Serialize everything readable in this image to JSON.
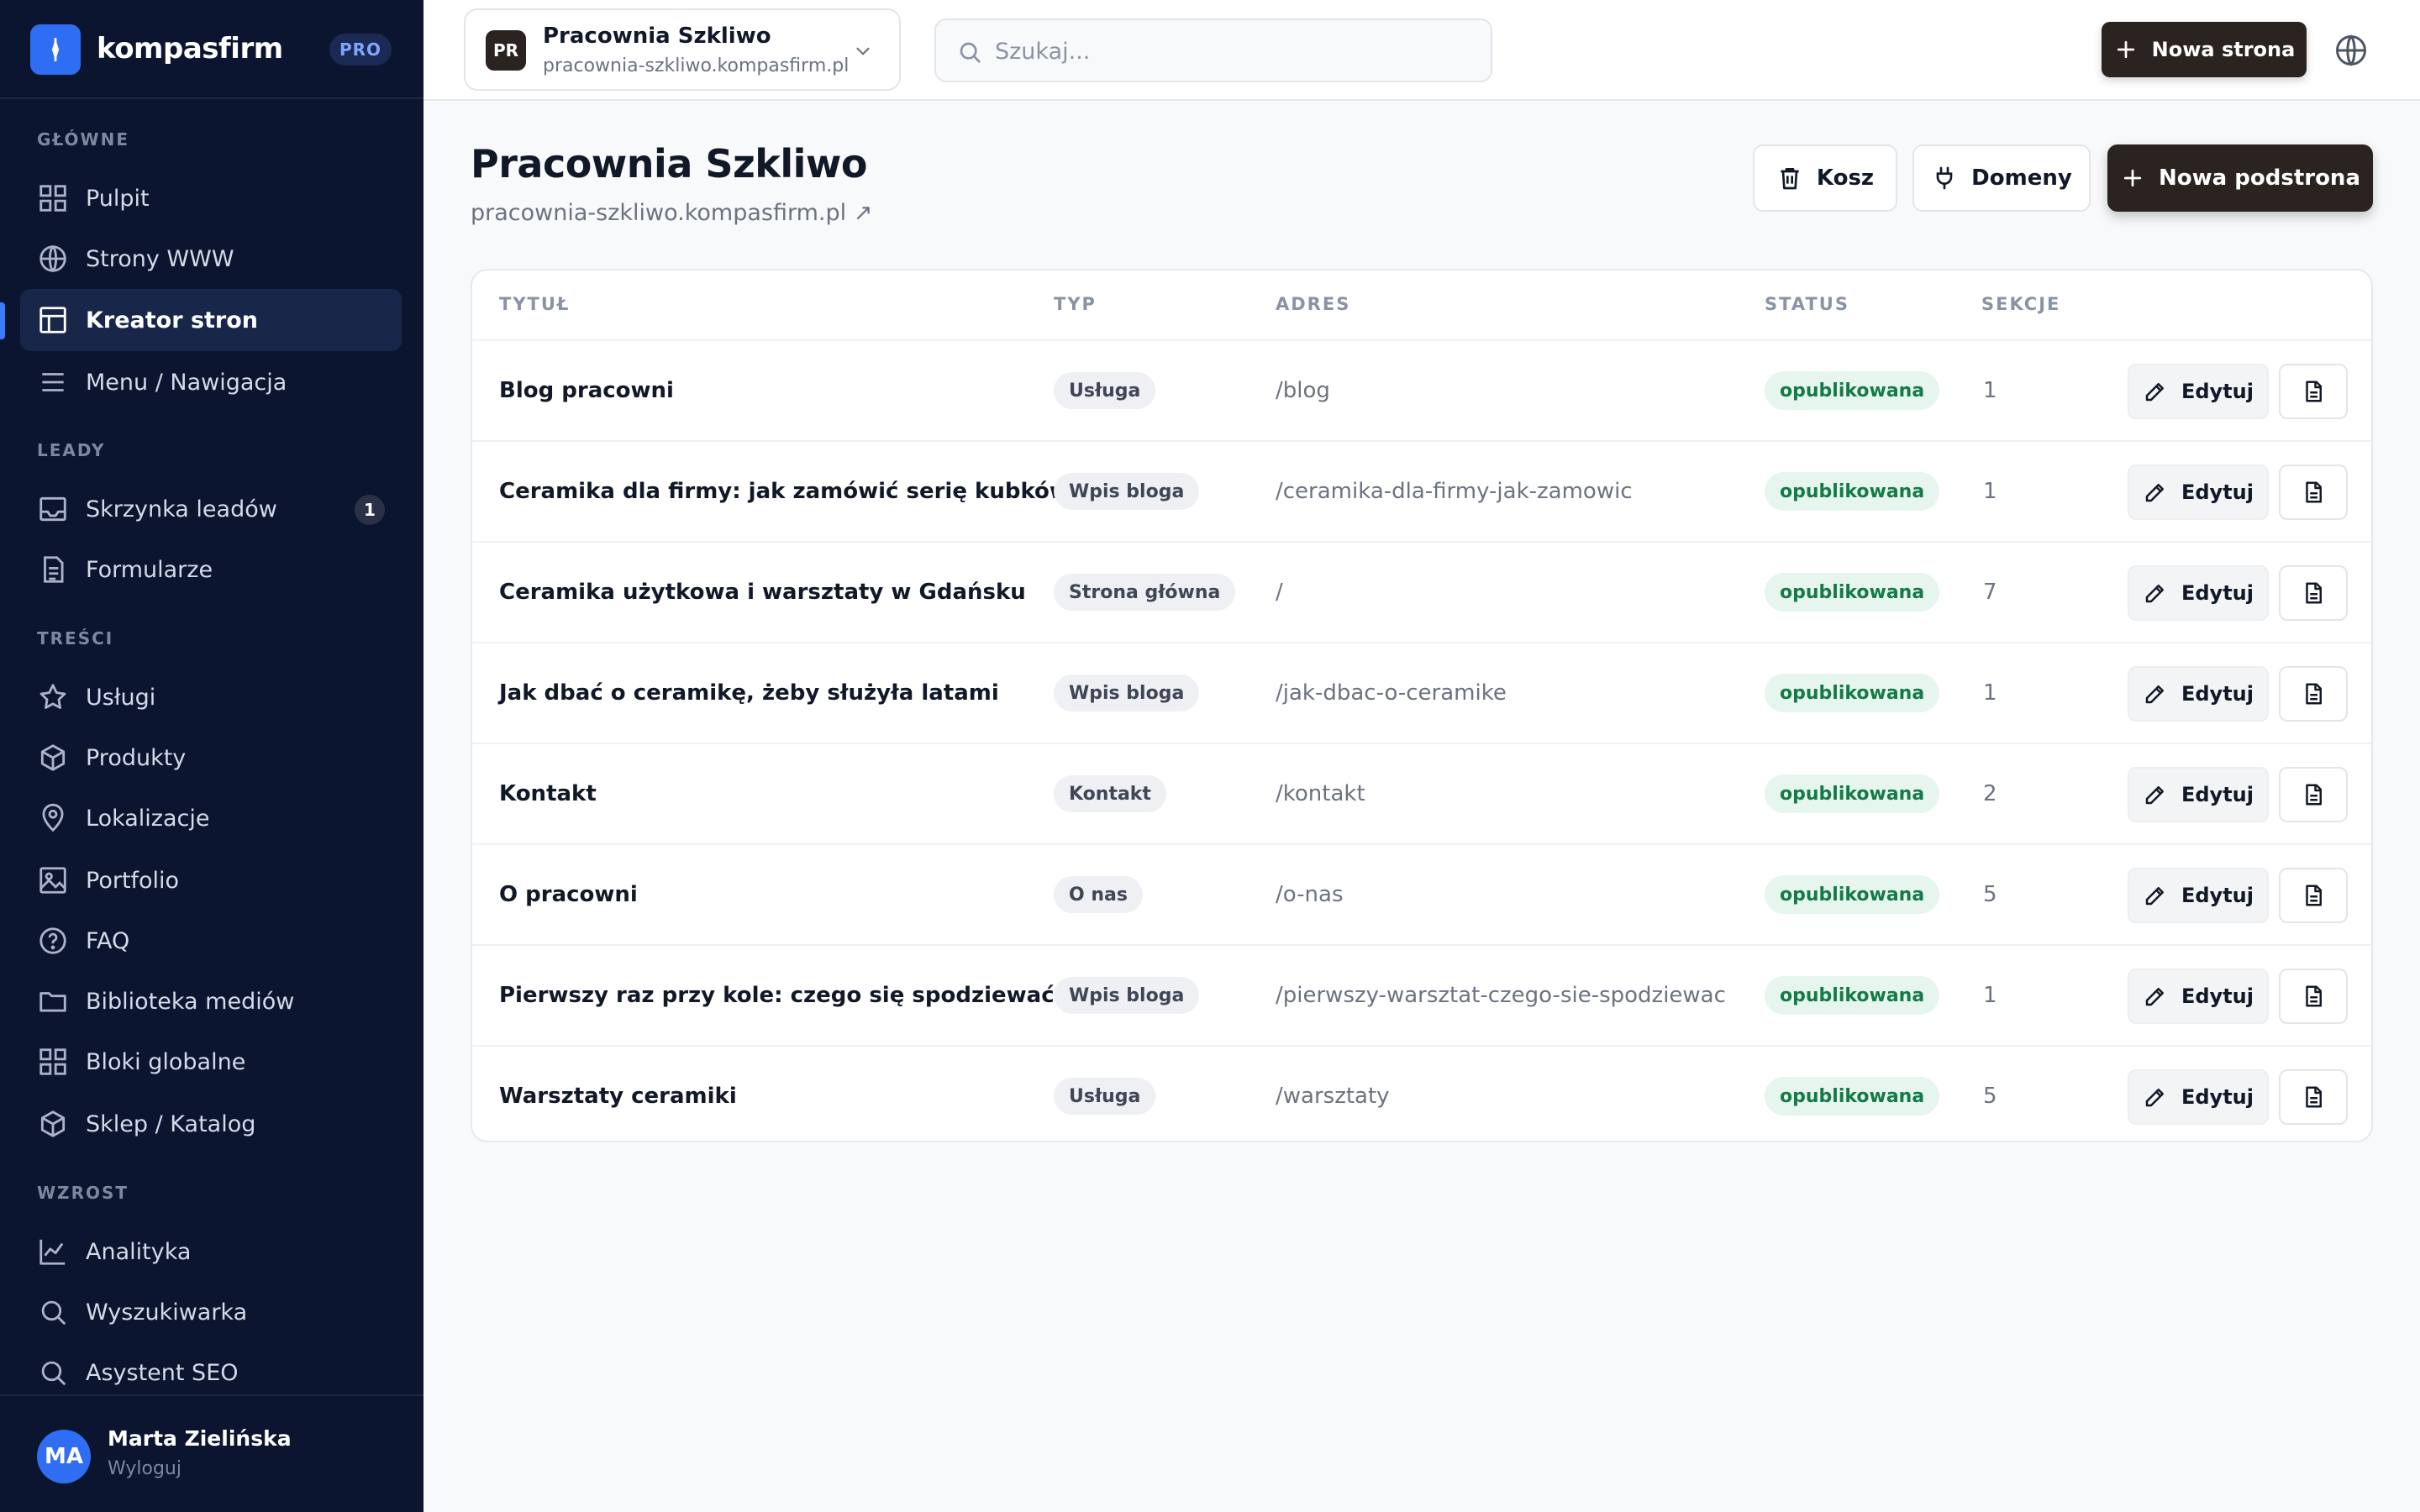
{
  "brand": {
    "name": "kompasfirm",
    "plan": "PRO"
  },
  "sidebar": {
    "sections": [
      {
        "title": "GŁÓWNE"
      },
      {
        "title": "LEADY"
      },
      {
        "title": "TREŚCI"
      },
      {
        "title": "WZROST"
      }
    ],
    "items": [
      {
        "label": "Pulpit",
        "icon": "grid-icon"
      },
      {
        "label": "Strony WWW",
        "icon": "globe-icon"
      },
      {
        "label": "Kreator stron",
        "icon": "layout-icon",
        "active": true
      },
      {
        "label": "Menu / Nawigacja",
        "icon": "menu-icon"
      },
      {
        "label": "Skrzynka leadów",
        "icon": "inbox-icon",
        "badge": "1"
      },
      {
        "label": "Formularze",
        "icon": "form-icon"
      },
      {
        "label": "Usługi",
        "icon": "star-icon"
      },
      {
        "label": "Produkty",
        "icon": "box-icon"
      },
      {
        "label": "Lokalizacje",
        "icon": "pin-icon"
      },
      {
        "label": "Portfolio",
        "icon": "image-icon"
      },
      {
        "label": "FAQ",
        "icon": "help-icon"
      },
      {
        "label": "Biblioteka mediów",
        "icon": "folder-icon"
      },
      {
        "label": "Bloki globalne",
        "icon": "grid-icon"
      },
      {
        "label": "Sklep / Katalog",
        "icon": "box-icon"
      },
      {
        "label": "Analityka",
        "icon": "chart-icon"
      },
      {
        "label": "Wyszukiwarka",
        "icon": "search-icon"
      },
      {
        "label": "Asystent SEO",
        "icon": "search-icon"
      }
    ]
  },
  "user": {
    "initials": "MA",
    "name": "Marta Zielińska",
    "logout": "Wyloguj"
  },
  "topbar": {
    "site": {
      "initials": "PR",
      "name": "Pracownia Szkliwo",
      "domain": "pracownia-szkliwo.kompasfirm.pl"
    },
    "search_placeholder": "Szukaj...",
    "new_site_label": "Nowa strona"
  },
  "page": {
    "title": "Pracownia Szkliwo",
    "link": "pracownia-szkliwo.kompasfirm.pl ↗",
    "trash_label": "Kosz",
    "domains_label": "Domeny",
    "new_subpage_label": "Nowa podstrona"
  },
  "table": {
    "columns": [
      "TYTUŁ",
      "TYP",
      "ADRES",
      "STATUS",
      "SEKCJE"
    ],
    "edit_label": "Edytuj",
    "rows": [
      {
        "title": "Blog pracowni",
        "type": "Usługa",
        "address": "/blog",
        "status": "opublikowana",
        "sections": "1"
      },
      {
        "title": "Ceramika dla firmy: jak zamówić serię kubków",
        "type": "Wpis bloga",
        "address": "/ceramika-dla-firmy-jak-zamowic",
        "status": "opublikowana",
        "sections": "1"
      },
      {
        "title": "Ceramika użytkowa i warsztaty w Gdańsku",
        "type": "Strona główna",
        "address": "/",
        "status": "opublikowana",
        "sections": "7"
      },
      {
        "title": "Jak dbać o ceramikę, żeby służyła latami",
        "type": "Wpis bloga",
        "address": "/jak-dbac-o-ceramike",
        "status": "opublikowana",
        "sections": "1"
      },
      {
        "title": "Kontakt",
        "type": "Kontakt",
        "address": "/kontakt",
        "status": "opublikowana",
        "sections": "2"
      },
      {
        "title": "O pracowni",
        "type": "O nas",
        "address": "/o-nas",
        "status": "opublikowana",
        "sections": "5"
      },
      {
        "title": "Pierwszy raz przy kole: czego się spodziewać",
        "type": "Wpis bloga",
        "address": "/pierwszy-warsztat-czego-sie-spodziewac",
        "status": "opublikowana",
        "sections": "1"
      },
      {
        "title": "Warsztaty ceramiki",
        "type": "Usługa",
        "address": "/warsztaty",
        "status": "opublikowana",
        "sections": "5"
      }
    ]
  },
  "colors": {
    "sidebar_bg": "#0c1530",
    "accent": "#2f6ef2",
    "primary_button": "#2a2320",
    "status_bg": "#e6f6ee",
    "status_text": "#157a47"
  }
}
